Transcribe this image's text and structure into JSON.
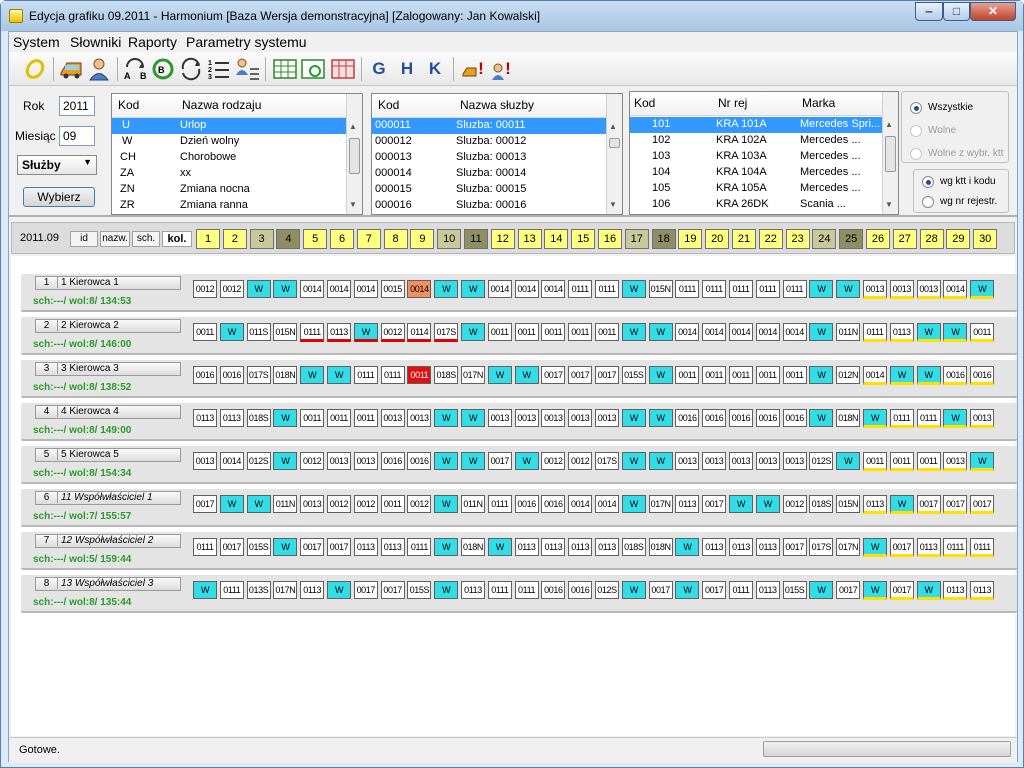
{
  "window": {
    "title": "Edycja grafiku 09.2011 -  Harmonium  [Baza Wersja demonstracyjna] [Zalogowany: Jan Kowalski]",
    "min": "‒",
    "max": "□",
    "close": "✕"
  },
  "menu": [
    "System",
    "Słowniki",
    "Raporty",
    "Parametry systemu"
  ],
  "toolbar": {
    "g": "G",
    "h": "H",
    "k": "K",
    "bang1": "!",
    "bang2": "!"
  },
  "filter": {
    "rok_label": "Rok",
    "rok_value": "2011",
    "miesiac_label": "Miesiąc",
    "miesiac_value": "09",
    "type_select": "Służby",
    "wybierz": "Wybierz"
  },
  "rodzaje": {
    "headers": [
      "Kod",
      "Nazwa rodzaju"
    ],
    "rows": [
      [
        "U",
        "Urlop"
      ],
      [
        "W",
        "Dzień wolny"
      ],
      [
        "CH",
        "Chorobowe"
      ],
      [
        "ZA",
        "xx"
      ],
      [
        "ZN",
        "Zmiana  nocna"
      ],
      [
        "ZR",
        "Zmiana ranna"
      ]
    ]
  },
  "sluzby": {
    "headers": [
      "Kod",
      "Nazwa słuzby"
    ],
    "rows": [
      [
        "000011",
        "Sluzba: 00011"
      ],
      [
        "000012",
        "Sluzba: 00012"
      ],
      [
        "000013",
        "Sluzba: 00013"
      ],
      [
        "000014",
        "Sluzba: 00014"
      ],
      [
        "000015",
        "Sluzba: 00015"
      ],
      [
        "000016",
        "Sluzba: 00016"
      ]
    ]
  },
  "pojazdy": {
    "headers": [
      "Kod",
      "Nr rej",
      "Marka"
    ],
    "rows": [
      [
        "101",
        "KRA  101A",
        "Mercedes Spri..."
      ],
      [
        "102",
        "KRA  102A",
        "Mercedes        ..."
      ],
      [
        "103",
        "KRA  103A",
        "Mercedes        ..."
      ],
      [
        "104",
        "KRA  104A",
        "Mercedes        ..."
      ],
      [
        "105",
        "KRA  105A",
        "Mercedes        ..."
      ],
      [
        "106",
        "KRA  26DK",
        "Scania           ..."
      ]
    ]
  },
  "radios": {
    "wszystkie": "Wszystkie",
    "wolne": "Wolne",
    "wolne_ktt": "Wolne z wybr. ktt",
    "wg_ktt": "wg ktt i kodu",
    "wg_nr": "wg nr rejestr."
  },
  "calendar": {
    "period": "2011.09",
    "sort_buttons": [
      "id",
      "nazw.",
      "sch.",
      "kol."
    ],
    "days": [
      "1",
      "2",
      "3",
      "4",
      "5",
      "6",
      "7",
      "8",
      "9",
      "10",
      "11",
      "12",
      "13",
      "14",
      "15",
      "16",
      "17",
      "18",
      "19",
      "20",
      "21",
      "22",
      "23",
      "24",
      "25",
      "26",
      "27",
      "28",
      "29",
      "30"
    ],
    "saturdays": [
      "3",
      "10",
      "17",
      "24"
    ],
    "sundays": [
      "4",
      "11",
      "18",
      "25"
    ]
  },
  "drivers": [
    {
      "num": "1",
      "name": "1 Kierowca 1",
      "stat": "sch:---/ wol:8/ 134:53",
      "cells": [
        "0012",
        "0012",
        "W",
        "W",
        "0014",
        "0014",
        "0014",
        "0015",
        "0014",
        "W",
        "W",
        "0014",
        "0014",
        "0014",
        "0111",
        "0111",
        "W",
        "015N",
        "0111",
        "0111",
        "0111",
        "0111",
        "0111",
        "W",
        "W",
        "0013",
        "0013",
        "0013",
        "0014",
        "W"
      ]
    },
    {
      "num": "2",
      "name": "2 Kierowca 2",
      "stat": "sch:---/ wol:8/ 146:00",
      "cells": [
        "0011",
        "W",
        "011S",
        "015N",
        "0111",
        "0113",
        "W",
        "0012",
        "0114",
        "017S",
        "W",
        "0011",
        "0011",
        "0011",
        "0011",
        "0011",
        "W",
        "W",
        "0014",
        "0014",
        "0014",
        "0014",
        "0014",
        "W",
        "011N",
        "0111",
        "0113",
        "W",
        "W",
        "0011"
      ]
    },
    {
      "num": "3",
      "name": "3 Kierowca 3",
      "stat": "sch:---/ wol:8/ 138:52",
      "cells": [
        "0016",
        "0016",
        "017S",
        "018N",
        "W",
        "W",
        "0111",
        "0111",
        "0011",
        "018S",
        "017N",
        "W",
        "W",
        "0017",
        "0017",
        "0017",
        "015S",
        "W",
        "0011",
        "0011",
        "0011",
        "0011",
        "0011",
        "W",
        "012N",
        "0014",
        "W",
        "W",
        "0016",
        "0016"
      ]
    },
    {
      "num": "4",
      "name": "4 Kierowca 4",
      "stat": "sch:---/ wol:8/ 149:00",
      "cells": [
        "0113",
        "0113",
        "018S",
        "W",
        "0011",
        "0011",
        "0011",
        "0013",
        "0013",
        "W",
        "W",
        "0013",
        "0013",
        "0013",
        "0013",
        "0013",
        "W",
        "W",
        "0016",
        "0016",
        "0016",
        "0016",
        "0016",
        "W",
        "018N",
        "W",
        "0111",
        "0111",
        "W",
        "0013"
      ]
    },
    {
      "num": "5",
      "name": "5 Kierowca 5",
      "stat": "sch:---/ wol:8/ 154:34",
      "cells": [
        "0013",
        "0014",
        "012S",
        "W",
        "0012",
        "0013",
        "0013",
        "0016",
        "0016",
        "W",
        "W",
        "0017",
        "W",
        "0012",
        "0012",
        "017S",
        "W",
        "W",
        "0013",
        "0013",
        "0013",
        "0013",
        "0013",
        "012S",
        "W",
        "0011",
        "0011",
        "0011",
        "0013",
        "W"
      ]
    },
    {
      "num": "6",
      "name": "11 Współwłaściciel 1",
      "stat": "sch:---/ wol:7/ 155:57",
      "cells": [
        "0017",
        "W",
        "W",
        "011N",
        "0013",
        "0012",
        "0012",
        "0011",
        "0012",
        "W",
        "011N",
        "0111",
        "0016",
        "0016",
        "0014",
        "0014",
        "W",
        "017N",
        "0113",
        "0017",
        "W",
        "W",
        "0012",
        "018S",
        "015N",
        "0113",
        "W",
        "0017",
        "0017",
        "0017"
      ]
    },
    {
      "num": "7",
      "name": "12 Współwłaściciel 2",
      "stat": "sch:---/ wol:5/ 159:44",
      "cells": [
        "0111",
        "0017",
        "015S",
        "W",
        "0017",
        "0017",
        "0113",
        "0113",
        "0111",
        "W",
        "018N",
        "W",
        "0113",
        "0113",
        "0113",
        "0113",
        "018S",
        "018N",
        "W",
        "0113",
        "0113",
        "0113",
        "0017",
        "017S",
        "017N",
        "W",
        "0017",
        "0113",
        "0111",
        "0111"
      ]
    },
    {
      "num": "8",
      "name": "13 Współwłaściciel 3",
      "stat": "sch:---/ wol:8/ 135:44",
      "cells": [
        "W",
        "0111",
        "013S",
        "017N",
        "0113",
        "W",
        "0017",
        "0017",
        "015S",
        "W",
        "0113",
        "0111",
        "0111",
        "0016",
        "0016",
        "012S",
        "W",
        "0017",
        "W",
        "0017",
        "0111",
        "0113",
        "015S",
        "W",
        "0017",
        "W",
        "0017",
        "W",
        "0113",
        "0113"
      ]
    }
  ],
  "status": "Gotowe.",
  "colors": {
    "free_day": "#33dde8",
    "weekday": "#ffff80",
    "saturday": "#c8c89a",
    "sunday": "#8e8e62",
    "selection": "#3399ff",
    "stats_green": "#2a9a2a"
  }
}
